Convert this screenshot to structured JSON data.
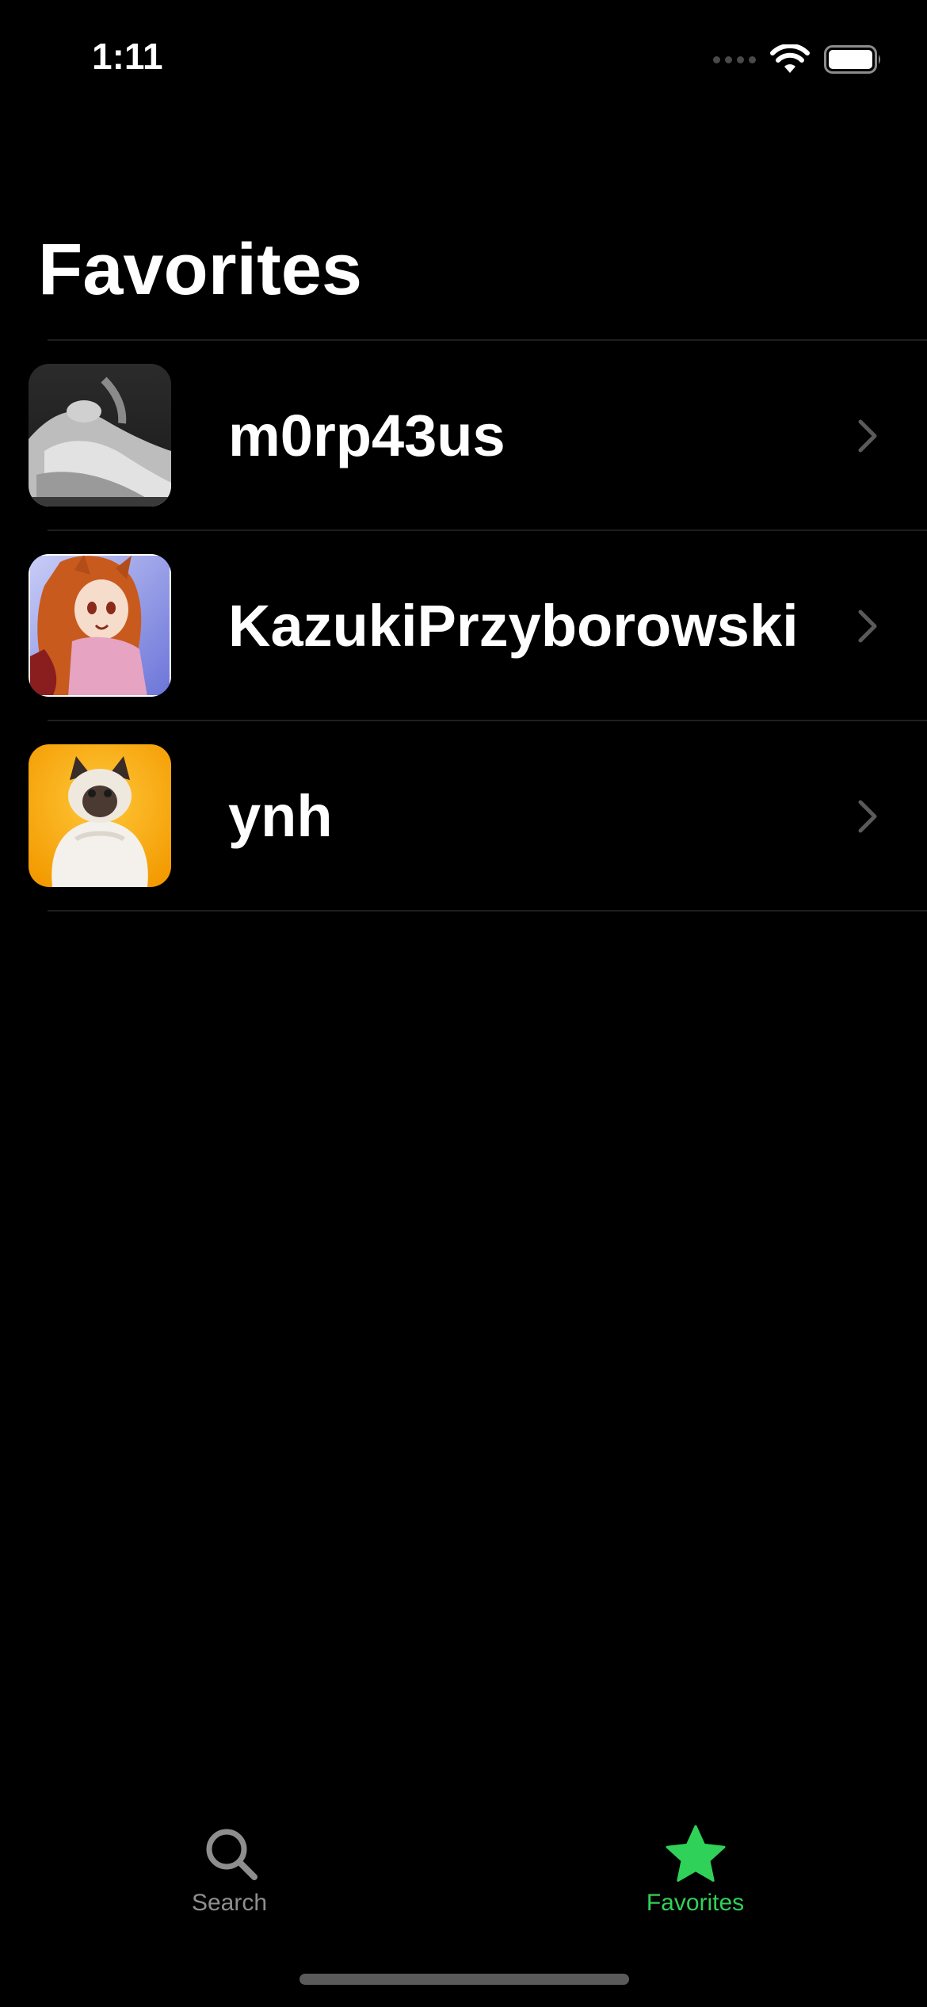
{
  "status_bar": {
    "time": "1:11",
    "icons": [
      "signal-dots-icon",
      "wifi-icon",
      "battery-icon"
    ]
  },
  "header": {
    "title": "Favorites"
  },
  "favorites": [
    {
      "name": "m0rp43us",
      "avatar": "statue-photo"
    },
    {
      "name": "KazukiPrzyborowski",
      "avatar": "anime-girl-illustration"
    },
    {
      "name": "ynh",
      "avatar": "cat-on-orange"
    }
  ],
  "tab_bar": {
    "tabs": [
      {
        "label": "Search",
        "icon": "search-icon",
        "selected": false
      },
      {
        "label": "Favorites",
        "icon": "star-icon",
        "selected": true
      }
    ]
  },
  "colors": {
    "background": "#000000",
    "accent": "#30d158",
    "inactive": "#8e8e8e",
    "divider": "#1e1e1e"
  }
}
